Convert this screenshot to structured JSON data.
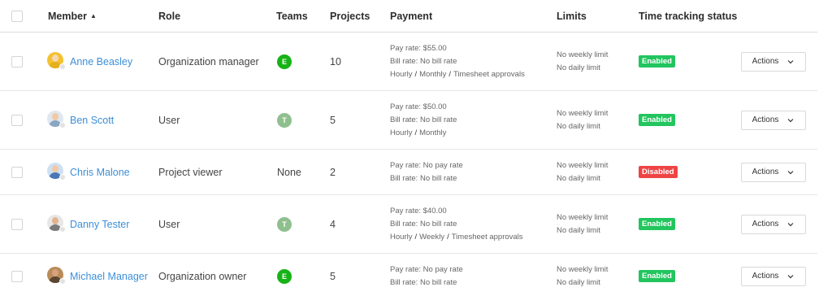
{
  "header": {
    "member": "Member",
    "role": "Role",
    "teams": "Teams",
    "projects": "Projects",
    "payment": "Payment",
    "limits": "Limits",
    "status": "Time tracking status"
  },
  "colors": {
    "enabled": "#22c55e",
    "disabled": "#ef4444",
    "team_e": "#16b316",
    "team_t": "#8fbf8f",
    "link": "#3d8fd8"
  },
  "rows": [
    {
      "name": "Anne Beasley",
      "role": "Organization manager",
      "team": "E",
      "projects": "10",
      "pay_rate": "Pay rate: $55.00",
      "bill_rate": "Bill rate: No bill rate",
      "links": [
        "Hourly",
        "Monthly",
        "Timesheet approvals"
      ],
      "weekly": "No weekly limit",
      "daily": "No daily limit",
      "status": "Enabled",
      "actions": "Actions"
    },
    {
      "name": "Ben Scott",
      "role": "User",
      "team": "T",
      "projects": "5",
      "pay_rate": "Pay rate: $50.00",
      "bill_rate": "Bill rate: No bill rate",
      "links": [
        "Hourly",
        "Monthly"
      ],
      "weekly": "No weekly limit",
      "daily": "No daily limit",
      "status": "Enabled",
      "actions": "Actions"
    },
    {
      "name": "Chris Malone",
      "role": "Project viewer",
      "team_text": "None",
      "projects": "2",
      "pay_rate": "Pay rate: No pay rate",
      "bill_rate": "Bill rate: No bill rate",
      "links": [],
      "weekly": "No weekly limit",
      "daily": "No daily limit",
      "status": "Disabled",
      "actions": "Actions"
    },
    {
      "name": "Danny Tester",
      "role": "User",
      "team": "T",
      "projects": "4",
      "pay_rate": "Pay rate: $40.00",
      "bill_rate": "Bill rate: No bill rate",
      "links": [
        "Hourly",
        "Weekly",
        "Timesheet approvals"
      ],
      "weekly": "No weekly limit",
      "daily": "No daily limit",
      "status": "Enabled",
      "actions": "Actions"
    },
    {
      "name": "Michael Manager",
      "role": "Organization owner",
      "team": "E",
      "projects": "5",
      "pay_rate": "Pay rate: No pay rate",
      "bill_rate": "Bill rate: No bill rate",
      "links": [],
      "weekly": "No weekly limit",
      "daily": "No daily limit",
      "status": "Enabled",
      "actions": "Actions"
    }
  ]
}
